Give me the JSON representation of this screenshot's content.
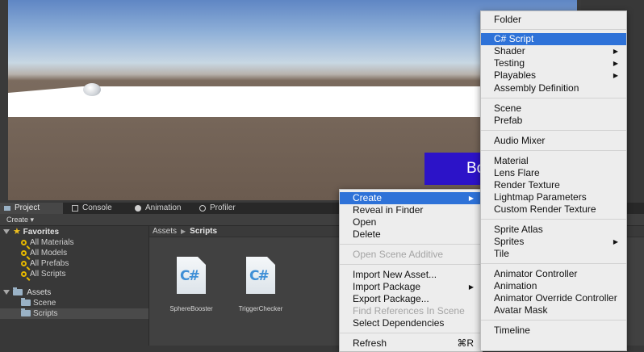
{
  "scene": {
    "ui_button_text": "Bo"
  },
  "tabs": [
    {
      "label": "Project",
      "icon": "folder-icon"
    },
    {
      "label": "Console",
      "icon": "console-icon"
    },
    {
      "label": "Animation",
      "icon": "animation-icon"
    },
    {
      "label": "Profiler",
      "icon": "profiler-icon"
    }
  ],
  "toolbar": {
    "create_label": "Create ▾"
  },
  "tree": {
    "favorites_label": "Favorites",
    "favorites": [
      "All Materials",
      "All Models",
      "All Prefabs",
      "All Scripts"
    ],
    "assets_label": "Assets",
    "assets_children": [
      "Scene",
      "Scripts"
    ]
  },
  "breadcrumb": {
    "root": "Assets",
    "current": "Scripts"
  },
  "files": [
    {
      "name": "SphereBooster",
      "icon_text": "C#"
    },
    {
      "name": "TriggerChecker",
      "icon_text": "C#"
    }
  ],
  "context_menu": {
    "items": [
      {
        "label": "Create",
        "arrow": "▶"
      },
      {
        "label": "Reveal in Finder"
      },
      {
        "label": "Open"
      },
      {
        "label": "Delete"
      },
      {
        "label": "Open Scene Additive"
      },
      {
        "label": "Import New Asset..."
      },
      {
        "label": "Import Package",
        "arrow": "▶"
      },
      {
        "label": "Export Package..."
      },
      {
        "label": "Find References In Scene"
      },
      {
        "label": "Select Dependencies"
      },
      {
        "label": "Refresh",
        "shortcut": "⌘R"
      }
    ]
  },
  "create_menu": {
    "items": [
      {
        "label": "Folder"
      },
      {
        "label": "C# Script"
      },
      {
        "label": "Shader",
        "arrow": "▶"
      },
      {
        "label": "Testing",
        "arrow": "▶"
      },
      {
        "label": "Playables",
        "arrow": "▶"
      },
      {
        "label": "Assembly Definition"
      },
      {
        "label": "Scene"
      },
      {
        "label": "Prefab"
      },
      {
        "label": "Audio Mixer"
      },
      {
        "label": "Material"
      },
      {
        "label": "Lens Flare"
      },
      {
        "label": "Render Texture"
      },
      {
        "label": "Lightmap Parameters"
      },
      {
        "label": "Custom Render Texture"
      },
      {
        "label": "Sprite Atlas"
      },
      {
        "label": "Sprites",
        "arrow": "▶"
      },
      {
        "label": "Tile"
      },
      {
        "label": "Animator Controller"
      },
      {
        "label": "Animation"
      },
      {
        "label": "Animator Override Controller"
      },
      {
        "label": "Avatar Mask"
      },
      {
        "label": "Timeline"
      }
    ]
  },
  "colors": {
    "highlight": "#2e72d8",
    "ui_button": "#2c13c8",
    "folder": "#9ab2c6",
    "favorite_icon": "#e6b800"
  }
}
